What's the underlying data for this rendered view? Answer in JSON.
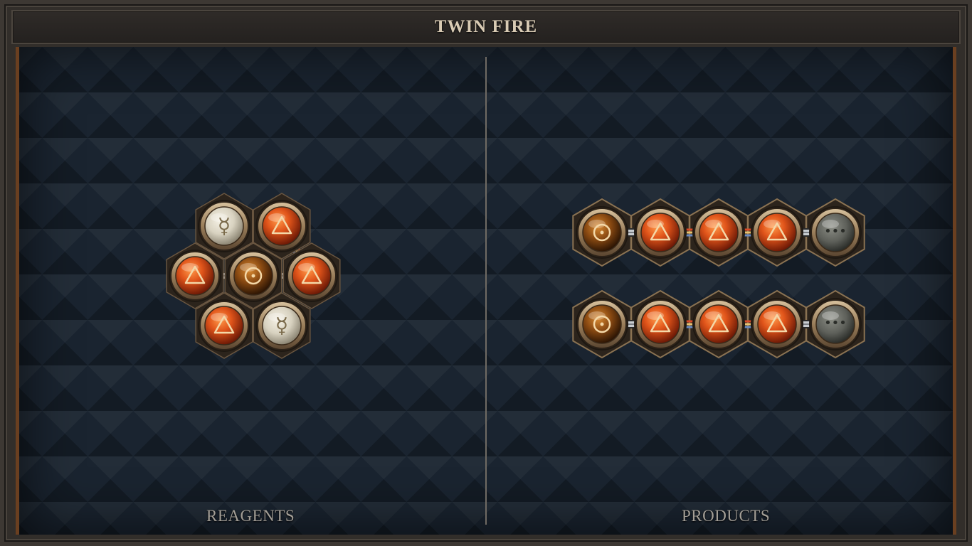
{
  "title": "TWIN FIRE",
  "panels": {
    "left_label": "REAGENTS",
    "right_label": "PRODUCTS"
  },
  "symbols": {
    "fire": "△",
    "salt": "☉",
    "quicksilver": "☿",
    "unknown": "•••"
  },
  "colors": {
    "fire_orb": "#e0541a",
    "salt_orb": "#8a4a12",
    "quicksilver_orb": "#d8d2c0",
    "unknown_orb": "#5e605a",
    "bezel": "#b49874",
    "glyph_light": "#f4d8a8"
  },
  "reagents": {
    "atoms": [
      {
        "id": "a1",
        "element": "quicksilver"
      },
      {
        "id": "a2",
        "element": "fire"
      },
      {
        "id": "a3",
        "element": "fire"
      },
      {
        "id": "a4",
        "element": "salt"
      },
      {
        "id": "a5",
        "element": "fire"
      },
      {
        "id": "a6",
        "element": "fire"
      },
      {
        "id": "a7",
        "element": "quicksilver"
      }
    ],
    "bonds": [
      {
        "from": "a1",
        "to": "a2",
        "type": "normal"
      },
      {
        "from": "a3",
        "to": "a4",
        "type": "normal"
      },
      {
        "from": "a4",
        "to": "a5",
        "type": "normal"
      },
      {
        "from": "a6",
        "to": "a7",
        "type": "normal"
      },
      {
        "from": "a2",
        "to": "a5",
        "type": "triplex"
      },
      {
        "from": "a3",
        "to": "a6",
        "type": "triplex"
      }
    ]
  },
  "products": [
    {
      "atoms": [
        "salt",
        "fire",
        "fire",
        "fire",
        "unknown"
      ],
      "bonds": [
        "normal",
        "triplex",
        "triplex",
        "normal"
      ]
    },
    {
      "atoms": [
        "salt",
        "fire",
        "fire",
        "fire",
        "unknown"
      ],
      "bonds": [
        "normal",
        "triplex",
        "triplex",
        "normal"
      ]
    }
  ]
}
